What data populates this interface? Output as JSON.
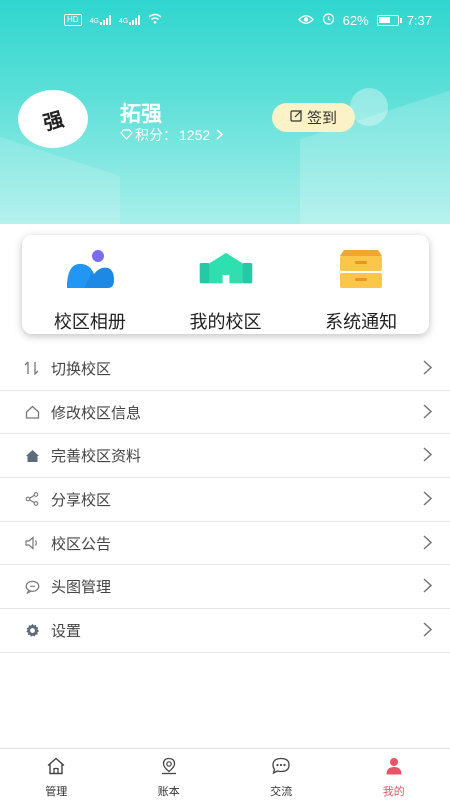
{
  "status_bar": {
    "network_badge": "HD",
    "signal_1": "4G",
    "signal_2": "4G",
    "battery_level": "62%",
    "battery_fraction": 0.62,
    "time": "7:37"
  },
  "profile": {
    "avatar_text": "强",
    "username": "拓强",
    "points_label": "积分：",
    "points_value": "1252",
    "checkin_label": "签到"
  },
  "cards": [
    {
      "label": "校区相册",
      "icon": "mountain-photo-icon",
      "color": "#2196f3"
    },
    {
      "label": "我的校区",
      "icon": "campus-building-icon",
      "color": "#2ee0b0"
    },
    {
      "label": "系统通知",
      "icon": "drawer-cabinet-icon",
      "color": "#fcc64a"
    }
  ],
  "menu": [
    {
      "label": "切换校区",
      "icon": "sort-arrows-icon"
    },
    {
      "label": "修改校区信息",
      "icon": "home-outline-icon"
    },
    {
      "label": "完善校区资料",
      "icon": "home-filled-icon"
    },
    {
      "label": "分享校区",
      "icon": "share-icon"
    },
    {
      "label": "校区公告",
      "icon": "speaker-icon"
    },
    {
      "label": "头图管理",
      "icon": "chat-bubble-icon"
    },
    {
      "label": "设置",
      "icon": "gear-icon"
    }
  ],
  "tabs": [
    {
      "label": "管理",
      "icon": "home-icon",
      "active": false
    },
    {
      "label": "账本",
      "icon": "location-pin-icon",
      "active": false
    },
    {
      "label": "交流",
      "icon": "chat-dots-icon",
      "active": false
    },
    {
      "label": "我的",
      "icon": "person-icon",
      "active": true
    }
  ],
  "colors": {
    "header_top": "#2fd6cf",
    "header_bottom": "#a8efea",
    "checkin_bg": "#fbf2c7",
    "active_tab": "#e8556a"
  }
}
